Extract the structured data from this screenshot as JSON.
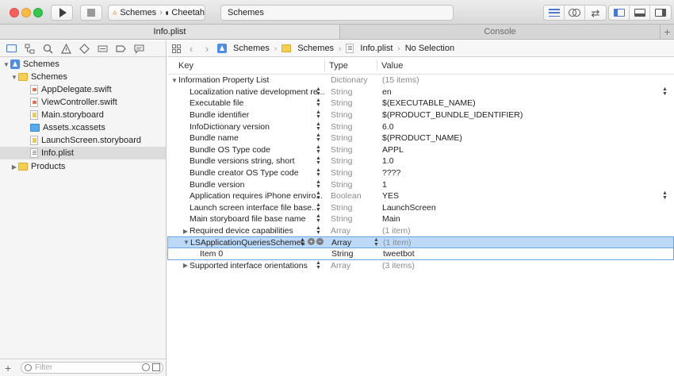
{
  "toolbar": {
    "scheme_target": "Schemes",
    "scheme_device": "Cheetah",
    "scheme_separator": "›",
    "activity_text": "Schemes"
  },
  "tabs": [
    {
      "label": "Info.plist",
      "active": true
    },
    {
      "label": "Console",
      "active": false
    }
  ],
  "tab_add_label": "+",
  "navigator": {
    "items": [
      {
        "label": "Schemes",
        "icon": "project-icon",
        "depth": 0,
        "disclosure": "▼"
      },
      {
        "label": "Schemes",
        "icon": "folder-icon",
        "depth": 1,
        "disclosure": "▼"
      },
      {
        "label": "AppDelegate.swift",
        "icon": "swift-file-icon",
        "depth": 2,
        "disclosure": ""
      },
      {
        "label": "ViewController.swift",
        "icon": "swift-file-icon",
        "depth": 2,
        "disclosure": ""
      },
      {
        "label": "Main.storyboard",
        "icon": "storyboard-file-icon",
        "depth": 2,
        "disclosure": ""
      },
      {
        "label": "Assets.xcassets",
        "icon": "asset-catalog-icon",
        "depth": 2,
        "disclosure": ""
      },
      {
        "label": "LaunchScreen.storyboard",
        "icon": "storyboard-file-icon",
        "depth": 2,
        "disclosure": ""
      },
      {
        "label": "Info.plist",
        "icon": "plist-file-icon",
        "depth": 2,
        "disclosure": "",
        "selected": true
      },
      {
        "label": "Products",
        "icon": "folder-icon",
        "depth": 1,
        "disclosure": "▶"
      }
    ],
    "filter_placeholder": "Filter",
    "add_label": "+"
  },
  "jumpbar": {
    "crumbs": [
      "Schemes",
      "Schemes",
      "Info.plist",
      "No Selection"
    ],
    "separator": "›"
  },
  "plist": {
    "headers": {
      "key": "Key",
      "type": "Type",
      "value": "Value"
    },
    "rows": [
      {
        "key": "Information Property List",
        "type": "Dictionary",
        "value": "(15 items)",
        "level": 0,
        "disclosure": "▼"
      },
      {
        "key": "Localization native development re...",
        "type": "String",
        "value": "en",
        "level": 1,
        "value_stepper": true
      },
      {
        "key": "Executable file",
        "type": "String",
        "value": "$(EXECUTABLE_NAME)",
        "level": 1
      },
      {
        "key": "Bundle identifier",
        "type": "String",
        "value": "$(PRODUCT_BUNDLE_IDENTIFIER)",
        "level": 1
      },
      {
        "key": "InfoDictionary version",
        "type": "String",
        "value": "6.0",
        "level": 1
      },
      {
        "key": "Bundle name",
        "type": "String",
        "value": "$(PRODUCT_NAME)",
        "level": 1
      },
      {
        "key": "Bundle OS Type code",
        "type": "String",
        "value": "APPL",
        "level": 1
      },
      {
        "key": "Bundle versions string, short",
        "type": "String",
        "value": "1.0",
        "level": 1
      },
      {
        "key": "Bundle creator OS Type code",
        "type": "String",
        "value": "????",
        "level": 1
      },
      {
        "key": "Bundle version",
        "type": "String",
        "value": "1",
        "level": 1
      },
      {
        "key": "Application requires iPhone enviro...",
        "type": "Boolean",
        "value": "YES",
        "level": 1,
        "value_stepper": true
      },
      {
        "key": "Launch screen interface file base...",
        "type": "String",
        "value": "LaunchScreen",
        "level": 1
      },
      {
        "key": "Main storyboard file base name",
        "type": "String",
        "value": "Main",
        "level": 1
      },
      {
        "key": "Required device capabilities",
        "type": "Array",
        "value": "(1 item)",
        "level": 1,
        "disclosure": "▶"
      },
      {
        "key": "LSApplicationQueriesSchemes",
        "type": "Array",
        "value": "(1 item)",
        "level": 1,
        "disclosure": "▼",
        "highlight": true
      },
      {
        "key": "Item 0",
        "type": "String",
        "value": "tweetbot",
        "level": 2,
        "child_selected": true
      },
      {
        "key": "Supported interface orientations",
        "type": "Array",
        "value": "(3 items)",
        "level": 1,
        "disclosure": "▶"
      }
    ],
    "stepper_glyph": "▲▼",
    "add_row_glyph": "+",
    "remove_row_glyph": "−"
  }
}
